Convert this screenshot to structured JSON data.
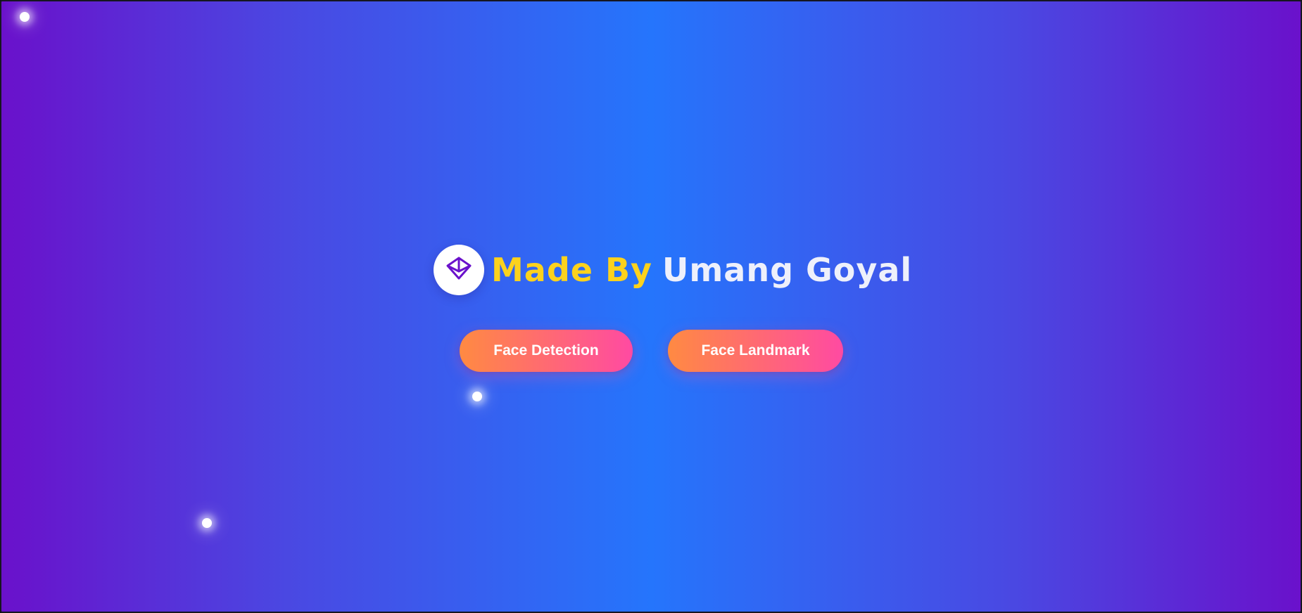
{
  "header": {
    "logo_icon": "diamond-icon",
    "title_accent": "Made By",
    "title_name": "Umang Goyal"
  },
  "actions": {
    "face_detection_label": "Face Detection",
    "face_landmark_label": "Face Landmark"
  },
  "colors": {
    "background_edge": "#6a11cb",
    "background_center": "#2575fc",
    "title_accent": "#fcd21d",
    "title_name": "#eef0fb",
    "button_gradient_start": "#ff8a42",
    "button_gradient_end": "#ff4aa2",
    "logo_icon": "#6a11cb"
  }
}
